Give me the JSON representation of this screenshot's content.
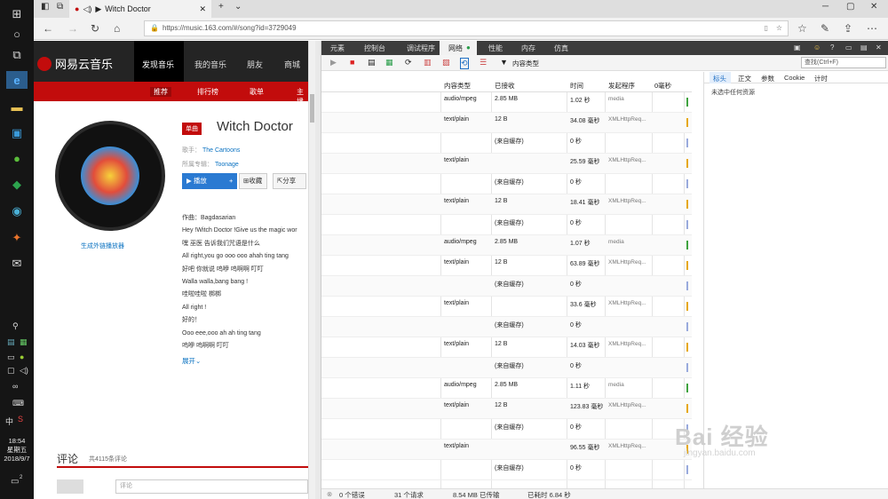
{
  "taskbar": {
    "clock_time": "18:54",
    "clock_day": "星期五",
    "clock_date": "2018/9/7",
    "notif_count": "2",
    "ime": "中"
  },
  "browser": {
    "tab_title": "Witch Doctor",
    "url": "https://music.163.com/#/song?id=3729049"
  },
  "site": {
    "logo": "网易云音乐",
    "nav": [
      "发现音乐",
      "我的音乐",
      "朋友",
      "商城"
    ],
    "subnav": [
      "推荐",
      "排行榜",
      "歌单",
      "主播电"
    ],
    "badge": "单曲",
    "song_title": "Witch Doctor",
    "singer_label": "歌手：",
    "singer": "The Cartoons",
    "album_label": "所属专辑：",
    "album": "Toonage",
    "play": "播放",
    "add": "+",
    "fav": "收藏",
    "share": "分享",
    "gen_player": "生成外链播放器",
    "lyrics": [
      "作曲：Bagdasarian",
      "Hey !Witch Doctor !Give us the magic wor",
      "嘿 巫医 告诉我们咒语是什么",
      "All right,you go ooo ooo ahah ting tang",
      "好吧 你就说 呜咿 呜啊啊 叮叮",
      "Walla walla,bang bang !",
      "哇啦哇啦 梆梆",
      "All right !",
      "好的！",
      "Ooo eee,ooo ah ah ting tang",
      "呜咿 呜啊啊 叮叮"
    ],
    "expand": "展开",
    "comments_title": "评论",
    "comments_count": "共4115条评论",
    "comment_placeholder": "评论"
  },
  "devtools": {
    "tabs": [
      "元素",
      "控制台",
      "调试程序",
      "网络",
      "性能",
      "内存",
      "仿真"
    ],
    "filter_label": "内容类型",
    "find_placeholder": "查找(Ctrl+F)",
    "columns": [
      "内容类型",
      "已接收",
      "时间",
      "发起程序",
      "0毫秒"
    ],
    "rows": [
      {
        "type": "audio/mpeg",
        "size": "2.85 MB",
        "time": "1.02 秒",
        "init": "media",
        "color": "#3fa33f"
      },
      {
        "type": "text/plain",
        "size": "12 B",
        "time": "34.08 毫秒",
        "init": "XMLHttpReq...",
        "color": "#e6a817"
      },
      {
        "type": "",
        "size": "(来自缓存)",
        "time": "0 秒",
        "init": "",
        "color": "#9ad"
      },
      {
        "type": "text/plain",
        "size": "",
        "time": "25.59 毫秒",
        "init": "XMLHttpReq...",
        "color": "#e6a817"
      },
      {
        "type": "",
        "size": "(来自缓存)",
        "time": "0 秒",
        "init": "",
        "color": "#9ad"
      },
      {
        "type": "text/plain",
        "size": "12 B",
        "time": "18.41 毫秒",
        "init": "XMLHttpReq...",
        "color": "#e6a817"
      },
      {
        "type": "",
        "size": "(来自缓存)",
        "time": "0 秒",
        "init": "",
        "color": "#9ad"
      },
      {
        "type": "audio/mpeg",
        "size": "2.85 MB",
        "time": "1.07 秒",
        "init": "media",
        "color": "#3fa33f"
      },
      {
        "type": "text/plain",
        "size": "12 B",
        "time": "63.89 毫秒",
        "init": "XMLHttpReq...",
        "color": "#e6a817"
      },
      {
        "type": "",
        "size": "(来自缓存)",
        "time": "0 秒",
        "init": "",
        "color": "#9ad"
      },
      {
        "type": "text/plain",
        "size": "",
        "time": "33.6 毫秒",
        "init": "XMLHttpReq...",
        "color": "#e6a817"
      },
      {
        "type": "",
        "size": "(来自缓存)",
        "time": "0 秒",
        "init": "",
        "color": "#9ad"
      },
      {
        "type": "text/plain",
        "size": "12 B",
        "time": "14.03 毫秒",
        "init": "XMLHttpReq...",
        "color": "#e6a817"
      },
      {
        "type": "",
        "size": "(来自缓存)",
        "time": "0 秒",
        "init": "",
        "color": "#9ad"
      },
      {
        "type": "audio/mpeg",
        "size": "2.85 MB",
        "time": "1.11 秒",
        "init": "media",
        "color": "#3fa33f"
      },
      {
        "type": "text/plain",
        "size": "12 B",
        "time": "123.83 毫秒",
        "init": "XMLHttpReq...",
        "color": "#e6a817"
      },
      {
        "type": "",
        "size": "(来自缓存)",
        "time": "0 秒",
        "init": "",
        "color": "#9ad"
      },
      {
        "type": "text/plain",
        "size": "",
        "time": "96.55 毫秒",
        "init": "XMLHttpReq...",
        "color": "#e6a817"
      },
      {
        "type": "",
        "size": "(来自缓存)",
        "time": "0 秒",
        "init": "",
        "color": "#9ad"
      }
    ],
    "detail_tabs": [
      "标头",
      "正文",
      "参数",
      "Cookie",
      "计时"
    ],
    "detail_empty": "未选中任何资源",
    "status": {
      "errors": "0 个错误",
      "requests": "31 个请求",
      "transferred": "8.54 MB 已传输",
      "elapsed": "已耗时 6.84 秒"
    }
  },
  "watermark": {
    "main": "Bai 经验",
    "sub": "jingyan.baidu.com"
  }
}
